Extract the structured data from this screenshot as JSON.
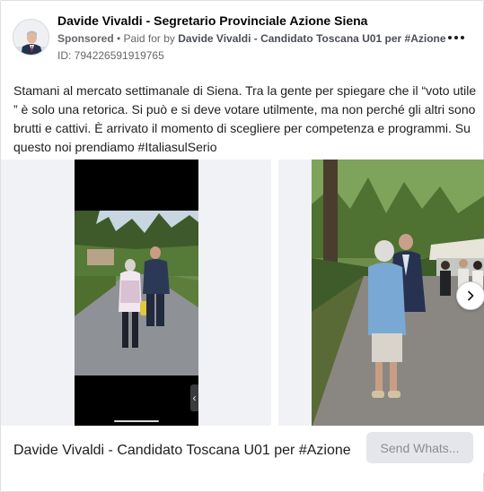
{
  "header": {
    "page_name": "Davide Vivaldi - Segretario Provinciale Azione Siena",
    "sponsored_label": "Sponsored",
    "paid_for_prefix": " • Paid for by ",
    "payer": "Davide Vivaldi - Candidato Toscana U01 per #Azione",
    "ad_id": "ID: 794226591919765",
    "more_icon": "more-horizontal-icon"
  },
  "post": {
    "text": "Stamani al mercato settimanale di Siena. Tra la gente per spiegare che il “voto utile ” è solo una retorica. Si può e si deve votare utilmente, ma non perché gli altri sono brutti e cattivi. È arrivato il momento di scegliere per competenza e programmi. Su questo noi prendiamo #ItaliasulSerio"
  },
  "carousel": {
    "slide_1": "video-frame",
    "slide_2": "photo",
    "next_icon": "chevron-right-icon",
    "phone_chevron": "‹"
  },
  "footer": {
    "title": "Davide Vivaldi - Candidato Toscana U01 per #Azione",
    "cta_label": "Send Whats..."
  },
  "colors": {
    "text": "#050505",
    "secondary": "#65676b",
    "button_bg": "#e4e6eb",
    "button_text": "#8a8d91"
  }
}
